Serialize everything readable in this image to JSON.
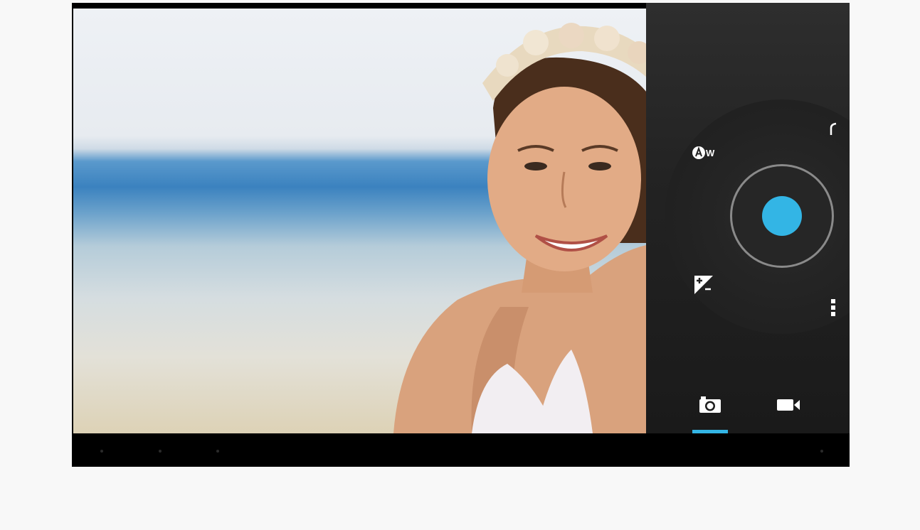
{
  "app": {
    "name": "Camera"
  },
  "viewfinder": {
    "subject": "preview-image"
  },
  "controls": {
    "white_balance_icon": "auto-white-balance-icon",
    "exposure_icon": "exposure-compensation-icon",
    "more_icon": "overflow-menu-icon",
    "pie_indicator_icon": "arc-indicator-icon",
    "shutter_icon": "shutter-button"
  },
  "modes": [
    {
      "name": "photo",
      "icon": "camera-icon",
      "selected": true
    },
    {
      "name": "video",
      "icon": "video-camera-icon",
      "selected": false
    }
  ],
  "colors": {
    "accent": "#33b5e5",
    "panel": "#232323",
    "navbar": "#000000"
  }
}
